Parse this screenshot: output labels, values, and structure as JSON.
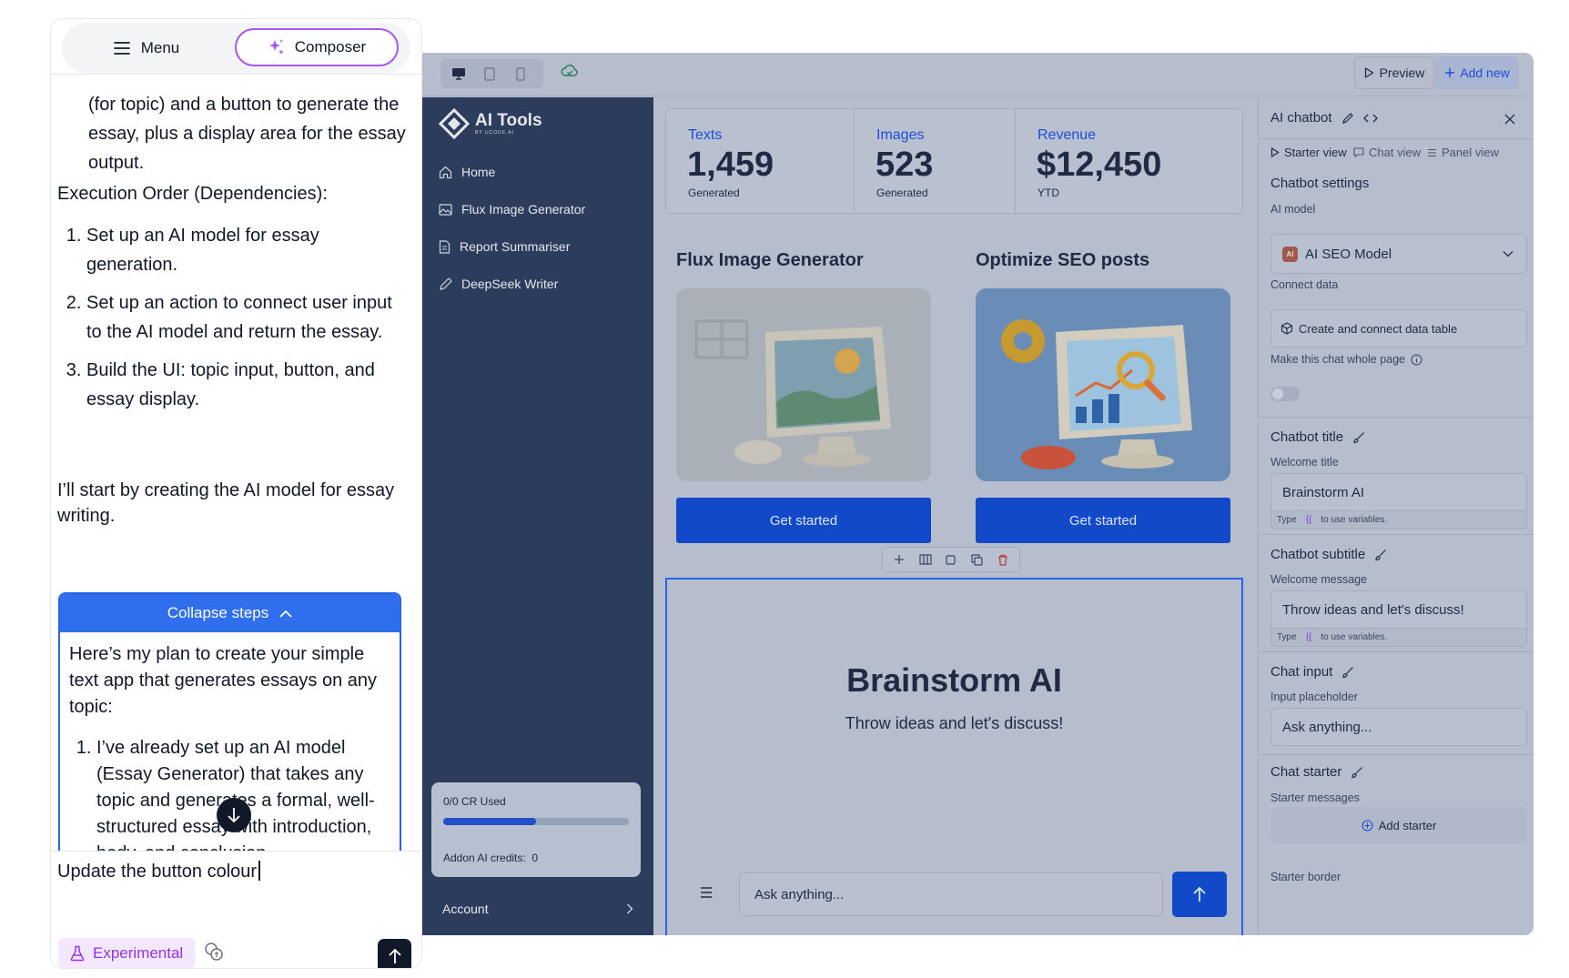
{
  "chat_panel": {
    "menu_label": "Menu",
    "composer_label": "Composer",
    "msg_partial": "(for topic) and a button to generate the essay, plus a display area for the essay output.",
    "execution_heading": "Execution Order (Dependencies):",
    "execution_steps": [
      "Set up an AI model for essay generation.",
      "Set up an action to connect user input to the AI model and return the essay.",
      "Build the UI: topic input, button, and essay display."
    ],
    "start_msg": "I’ll start by creating the AI model for essay writing.",
    "collapse_label": "Collapse steps",
    "plan_intro": "Here’s my plan to create your simple text app that generates essays on any topic:",
    "plan_steps": [
      "I’ve already set up an AI model (Essay Generator) that takes any topic and generates a formal, well-structured essay with introduction, body, and conclusion."
    ],
    "input_value": "Update the button colour",
    "experimental_label": "Experimental"
  },
  "builder": {
    "toolbar": {
      "preview_label": "Preview",
      "add_new_label": "Add new"
    },
    "app_sidebar": {
      "logo_title": "AI Tools",
      "logo_sub": "BY UCODE.AI",
      "nav": [
        {
          "label": "Home",
          "icon": "home-icon"
        },
        {
          "label": "Flux Image Generator",
          "icon": "image-icon"
        },
        {
          "label": "Report Summariser",
          "icon": "document-icon"
        },
        {
          "label": "DeepSeek Writer",
          "icon": "pencil-icon"
        }
      ],
      "credits_used": "0/0 CR Used",
      "credits_progress": 0.5,
      "addon_label": "Addon AI credits:",
      "addon_value": "0",
      "account_label": "Account"
    },
    "stats": [
      {
        "label": "Texts",
        "value": "1,459",
        "sub": "Generated"
      },
      {
        "label": "Images",
        "value": "523",
        "sub": "Generated"
      },
      {
        "label": "Revenue",
        "value": "$12,450",
        "sub": "YTD"
      }
    ],
    "cards": [
      {
        "title": "Flux Image Generator",
        "button": "Get started"
      },
      {
        "title": "Optimize SEO posts",
        "button": "Get started"
      }
    ],
    "chatbot": {
      "title": "Brainstorm AI",
      "subtitle": "Throw ideas and let's discuss!",
      "placeholder": "Ask anything..."
    },
    "settings": {
      "panel_title": "AI chatbot",
      "tabs": [
        "Starter view",
        "Chat view",
        "Panel view"
      ],
      "chatbot_settings": "Chatbot settings",
      "ai_model_label": "AI model",
      "ai_model_badge": "AI",
      "ai_model_value": "AI SEO Model",
      "connect_label": "Connect data",
      "connect_button": "Create and connect data table",
      "whole_page_label": "Make this chat whole page",
      "whole_page_enabled": false,
      "title_section": "Chatbot title",
      "welcome_title_label": "Welcome title",
      "welcome_title_value": "Brainstorm AI",
      "hint_type": "Type",
      "hint_var": "{{",
      "hint_rest": "to use variables.",
      "subtitle_section": "Chatbot subtitle",
      "welcome_msg_label": "Welcome message",
      "welcome_msg_value": "Throw ideas and let's discuss!",
      "input_section": "Chat input",
      "placeholder_label": "Input placeholder",
      "placeholder_value": "Ask anything...",
      "starter_section": "Chat starter",
      "starter_msgs_label": "Starter messages",
      "add_starter_label": "Add starter",
      "starter_border_label": "Starter border"
    }
  }
}
